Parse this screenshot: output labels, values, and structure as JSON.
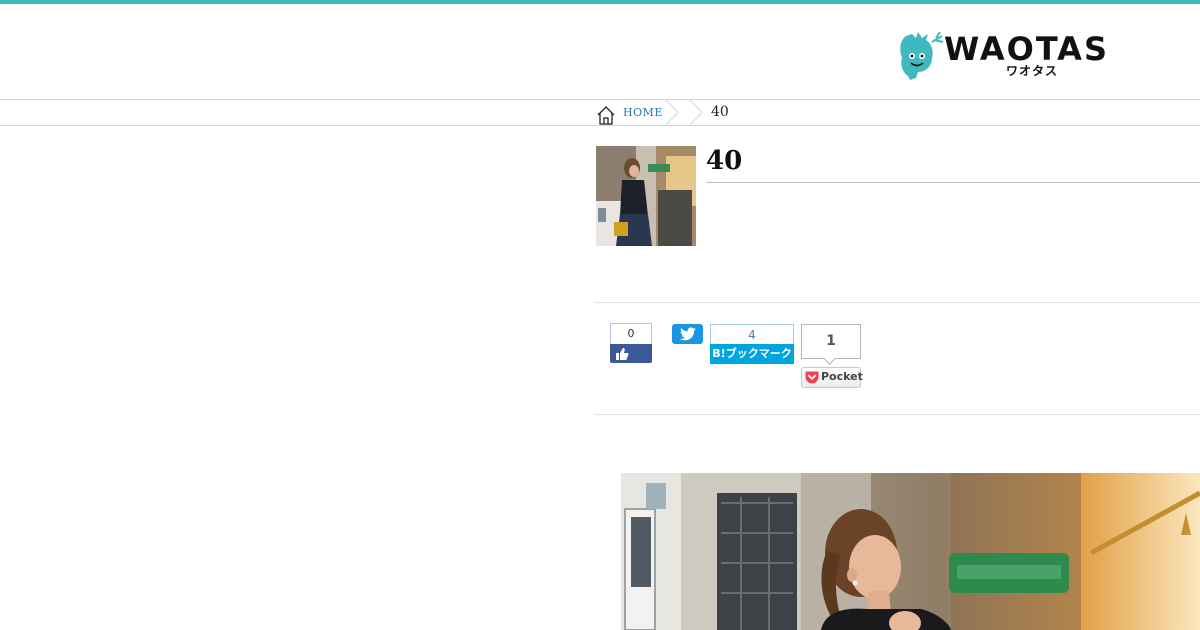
{
  "header": {
    "logo_text": "WAOTAS",
    "logo_subtext": "ワオタス"
  },
  "breadcrumb": {
    "home_label": "HOME",
    "current": "40"
  },
  "post": {
    "title": "40"
  },
  "share": {
    "facebook_count": "0",
    "hatena_count": "4",
    "hatena_label": "B!ブックマーク",
    "pocket_count": "1",
    "pocket_label": "Pocket"
  },
  "colors": {
    "accent": "#3fb8bf",
    "link": "#2b7aa8",
    "facebook": "#3b5998",
    "twitter": "#1b95e0",
    "hatena": "#00a4de",
    "pocket": "#ef4056"
  },
  "icons": {
    "logo": "waotas-mascot-icon",
    "home": "home-icon",
    "facebook": "thumbs-up-icon",
    "twitter": "twitter-bird-icon",
    "pocket": "pocket-icon"
  }
}
